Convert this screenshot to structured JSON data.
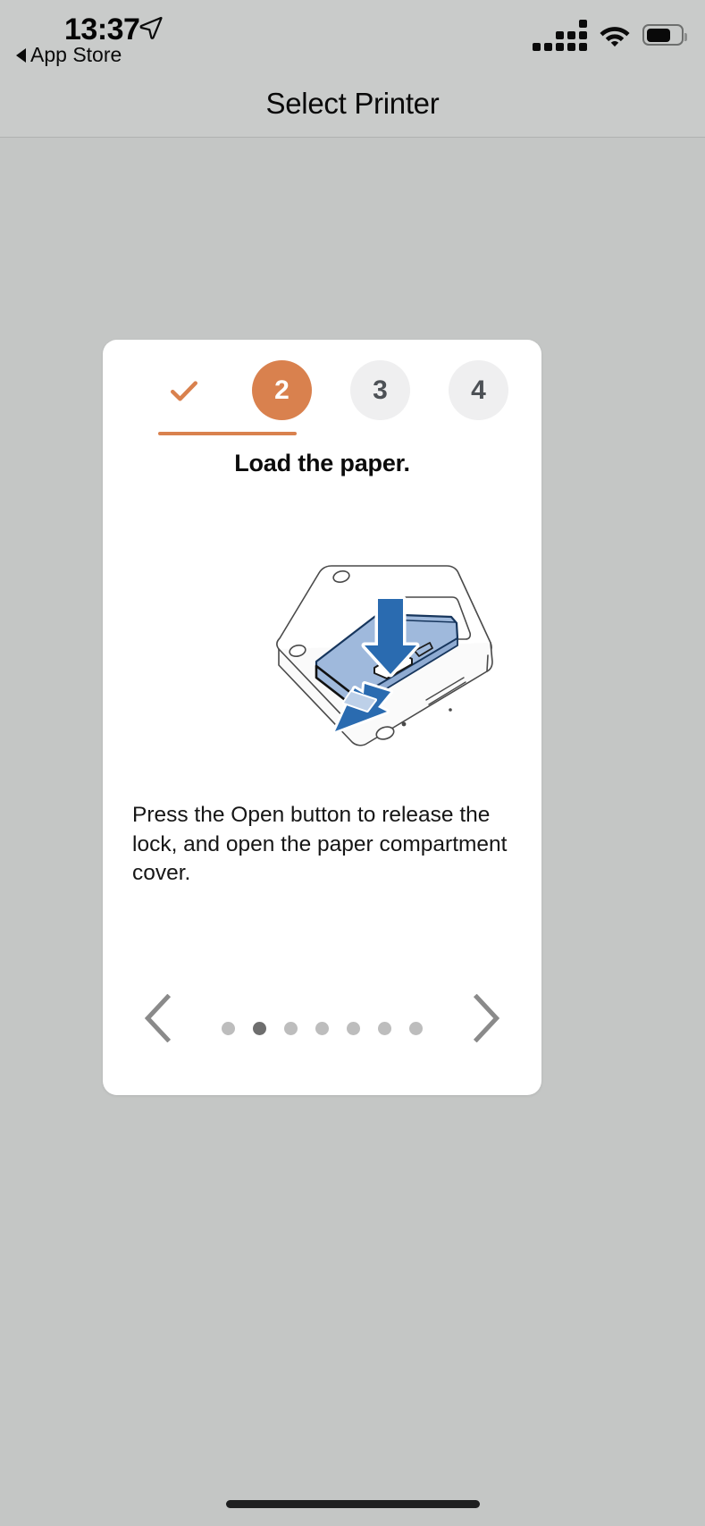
{
  "status_bar": {
    "time": "13:37",
    "location_icon": "location-arrow-icon",
    "back_label": "App Store",
    "cellular_icon": "cellular-signal-icon",
    "cellular_bars": 4,
    "wifi_icon": "wifi-icon",
    "battery_icon": "battery-icon",
    "battery_level_percent": 72
  },
  "nav_bar": {
    "title": "Select Printer"
  },
  "card": {
    "stepper": {
      "steps": [
        {
          "label": "",
          "state": "done",
          "icon": "check-icon"
        },
        {
          "label": "2",
          "state": "current",
          "icon": ""
        },
        {
          "label": "3",
          "state": "todo",
          "icon": ""
        },
        {
          "label": "4",
          "state": "todo",
          "icon": ""
        }
      ],
      "accent_color": "#d9814e",
      "inactive_color": "#efeff0"
    },
    "title": "Load the paper.",
    "illustration": {
      "name": "printer-load-paper-illustration",
      "alt": "Printer with paper compartment cover and Open button, blue arrow pressing down and cover opening outward"
    },
    "body_text": "Press the Open button to release the lock, and open the paper compartment cover.",
    "footer": {
      "prev_icon": "chevron-left-icon",
      "next_icon": "chevron-right-icon",
      "dots_total": 7,
      "dots_active_index": 1
    }
  },
  "home_indicator": "home-indicator"
}
